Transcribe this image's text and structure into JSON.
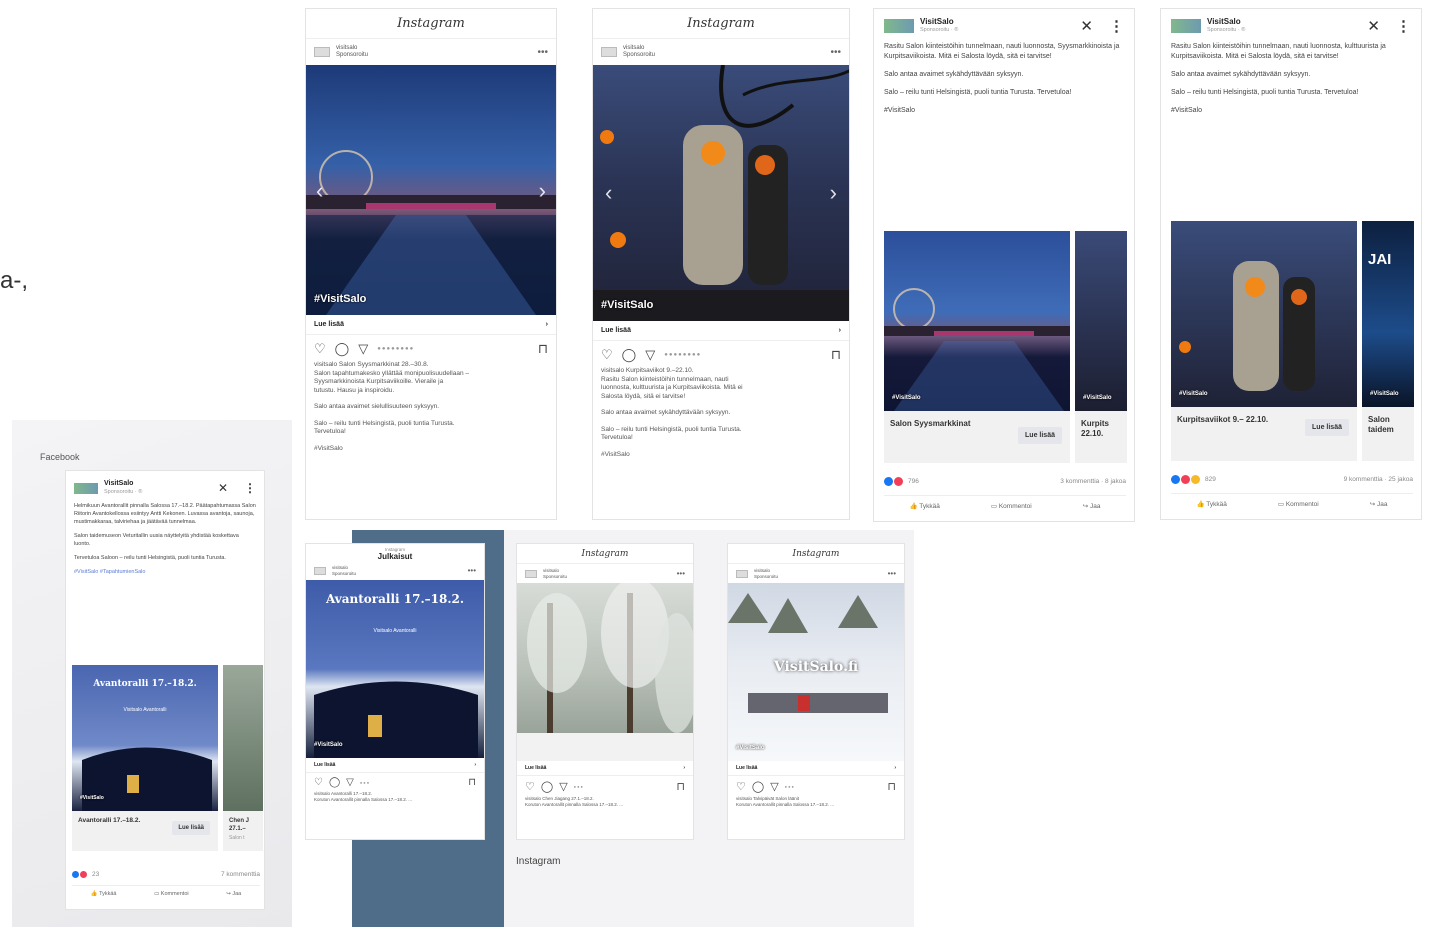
{
  "edge_text": "a-,",
  "sections": {
    "facebook_label": "Facebook",
    "instagram_label": "Instagram"
  },
  "ig_brand": "Instagram",
  "igA": {
    "account": "visitsalo",
    "sponsored": "Sponsoroitu",
    "hashtag": "#VisitSalo",
    "read_more": "Lue lisää",
    "lines": [
      "visitsalo Salon Syysmarkkinat 28.–30.8.",
      "Salon tapahtumakesko yllättää monipuolisuudellaan –",
      "Syysmarkkinoista Kurpitsaviikoille. Vieraile ja",
      "tutustu. Hausu ja inspiroidu.",
      "Salo antaa avaimet sielullisuuteen syksyyn.",
      "Salo – reilu tunti Helsingistä, puoli tuntia Turusta.",
      "Tervetuloa!",
      "#VisitSalo"
    ]
  },
  "igB": {
    "account": "visitsalo",
    "sponsored": "Sponsoroitu",
    "hashtag": "#VisitSalo",
    "read_more": "Lue lisää",
    "lines": [
      "visitsalo Kurpitsaviikot 9.–22.10.",
      "Rasitu Salon kiinteistöihin tunnelmaan, nauti",
      "luonnosta, kulttuurista ja Kurpitsaviikoista. Mitä ei",
      "Salosta löydä, sitä ei tarvitse!",
      "Salo antaa avaimet sykähdyttävään syksyyn.",
      "Salo – reilu tunti Helsingistä, puoli tuntia Turusta.",
      "Tervetuloa!",
      "#VisitSalo"
    ]
  },
  "fbA": {
    "name": "VisitSalo",
    "sponsored": "Sponsoroitu · ®",
    "paragraphs": [
      "Rasitu Salon kiinteistöihin tunnelmaan, nauti luonnosta, Syysmarkkinoista ja Kurpitsaviikoista. Mitä ei Salosta löydä, sitä ei tarvitse!",
      "Salo antaa avaimet sykähdyttävään syksyyn.",
      "Salo – reilu tunti Helsingistä, puoli tuntia Turusta. Tervetuloa!",
      "#VisitSalo"
    ],
    "item1_title": "Salon Syysmarkkinat",
    "item1_btn": "Lue lisää",
    "item2_title": "Kurpits 22.10.",
    "photo_tag": "#VisitSalo",
    "reactions": "796",
    "comments": "3 kommenttia · 8 jakoa",
    "like": "Tykkää",
    "comment": "Kommentoi",
    "share": "Jaa"
  },
  "fbB": {
    "name": "VisitSalo",
    "sponsored": "Sponsoroitu · ®",
    "paragraphs": [
      "Rasitu Salon kiinteistöihin tunnelmaan, nauti luonnosta, kulttuurista ja Kurpitsaviikoista. Mitä ei Salosta löydä, sitä ei tarvitse!",
      "Salo antaa avaimet sykähdyttävään syksyyn.",
      "Salo – reilu tunti Helsingistä, puoli tuntia Turusta. Tervetuloa!",
      "#VisitSalo"
    ],
    "item1_title": "Kurpitsaviikot 9.– 22.10.",
    "item1_btn": "Lue lisää",
    "item2_title": "Salon taidem",
    "item2_text": "JAI",
    "photo_tag": "#VisitSalo",
    "reactions": "829",
    "comments": "9 kommenttia · 25 jakoa",
    "like": "Tykkää",
    "comment": "Kommentoi",
    "share": "Jaa"
  },
  "fbC": {
    "name": "VisitSalo",
    "sponsored": "Sponsoroitu · ®",
    "paragraphs": [
      "Helmikuun Avantorallit pinnalla Salossa 17.–18.2. Päätapahtumassa Salon Riitorin Avantokellossa esiintyy Antti Kekonen. Luvassa avantoja, saunoja, mustimakkaraa, talviriehaa ja jäätävää tunnelmaa.",
      "Salon taidemuseon Veturitallin uusia näyttelyitä yhdistää koskettava luonto.",
      "Tervetuloa Saloon – reilu tunti Helsingistä, puoli tuntia Turusta.",
      "#VisitSalo #TapahtumienSalo"
    ],
    "item1_title": "Avantoralli 17.–18.2.",
    "item1_btn": "Lue lisää",
    "item2_title": "Chen J 27.1.–",
    "item2_sub": "Salon t",
    "poster_title": "Avantoralli 17.–18.2.",
    "poster_sub": "Visitsalo Avantoralli",
    "photo_tag": "#VisitSalo",
    "reactions": "23",
    "comments": "7 kommenttia",
    "like": "Tykkää",
    "comment": "Kommentoi",
    "share": "Jaa"
  },
  "igStory": {
    "top_small": "Instagram",
    "title": "Julkaisut",
    "account": "visitsalo",
    "sponsored": "Sponsoroitu",
    "poster_title": "Avantoralli 17.–18.2.",
    "poster_sub": "Visitsalo Avantoralli",
    "hashtag": "#VisitSalo",
    "read_more": "Lue lisää",
    "lines": [
      "visitsalo Avantoralli 17.–18.2.",
      "Koruton Avantorallit pinnalla Salossa 17.–18.2. ..."
    ]
  },
  "igWinter": {
    "account": "visitsalo",
    "sponsored": "Sponsoroitu",
    "read_more": "Lue lisää",
    "lines": [
      "visitsalo Chen Jiagang 27.1.–18.2.",
      "Koruton Avantorallit pinnalla Salossa 17.–18.2. ..."
    ]
  },
  "igSki": {
    "account": "visitsalo",
    "sponsored": "Sponsoroitu",
    "overlay": "VisitSalo.fi",
    "hashtag": "#VisitSalo",
    "read_more": "Lue lisää",
    "lines": [
      "visitsalo Talvipäivät Salon läänit",
      "Koruton Avantorallit pinnalla Salossa 17.–18.2. ..."
    ]
  },
  "colors": {
    "panel_blue": "#4f6c88",
    "fb_blue": "#1877f2",
    "fb_red": "#f33e58"
  },
  "icons": [
    "heart-icon",
    "comment-icon",
    "send-icon",
    "bookmark-icon",
    "close-icon",
    "kebab-icon",
    "like-icon",
    "chevron-right-icon"
  ]
}
